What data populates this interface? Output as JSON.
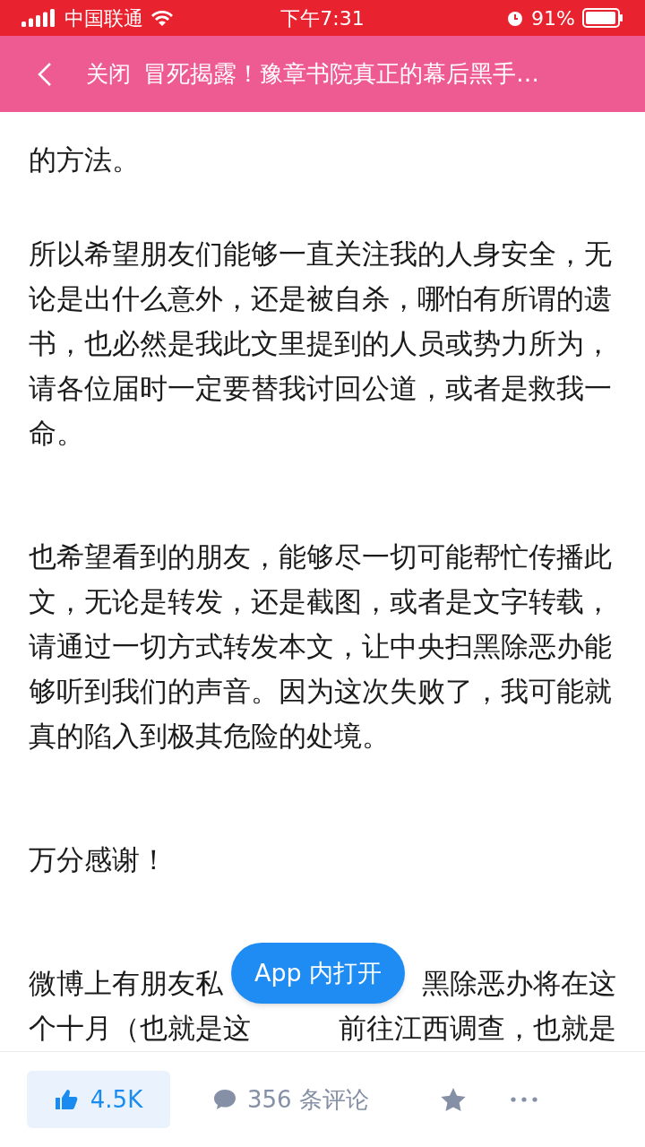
{
  "status_bar": {
    "carrier": "中国联通",
    "time": "下午7:31",
    "battery": "91%"
  },
  "header": {
    "close_label": "关闭",
    "title": "冒死揭露！豫章书院真正的幕后黑手…"
  },
  "article": {
    "paragraphs": [
      "的方法。",
      "所以希望朋友们能够一直关注我的人身安全，无论是出什么意外，还是被自杀，哪怕有所谓的遗书，也必然是我此文里提到的人员或势力所为，请各位届时一定要替我讨回公道，或者是救我一命。",
      "也希望看到的朋友，能够尽一切可能帮忙传播此文，无论是转发，还是截图，或者是文字转载，请通过一切方式转发本文，让中央扫黑除恶办能够听到我们的声音。因为这次失败了，我可能就真的陷入到极其危险的处境。",
      "万分感谢！"
    ],
    "covered_paragraph": {
      "lines": [
        {
          "left": "微博上有朋友私",
          "right": "黑除恶办将在这"
        },
        {
          "left": "个十月（也就是这",
          "right": "前往江西调查，也就是"
        }
      ]
    }
  },
  "open_in_app": "App 内打开",
  "bottom_bar": {
    "likes": "4.5K",
    "comments": "356 条评论"
  }
}
